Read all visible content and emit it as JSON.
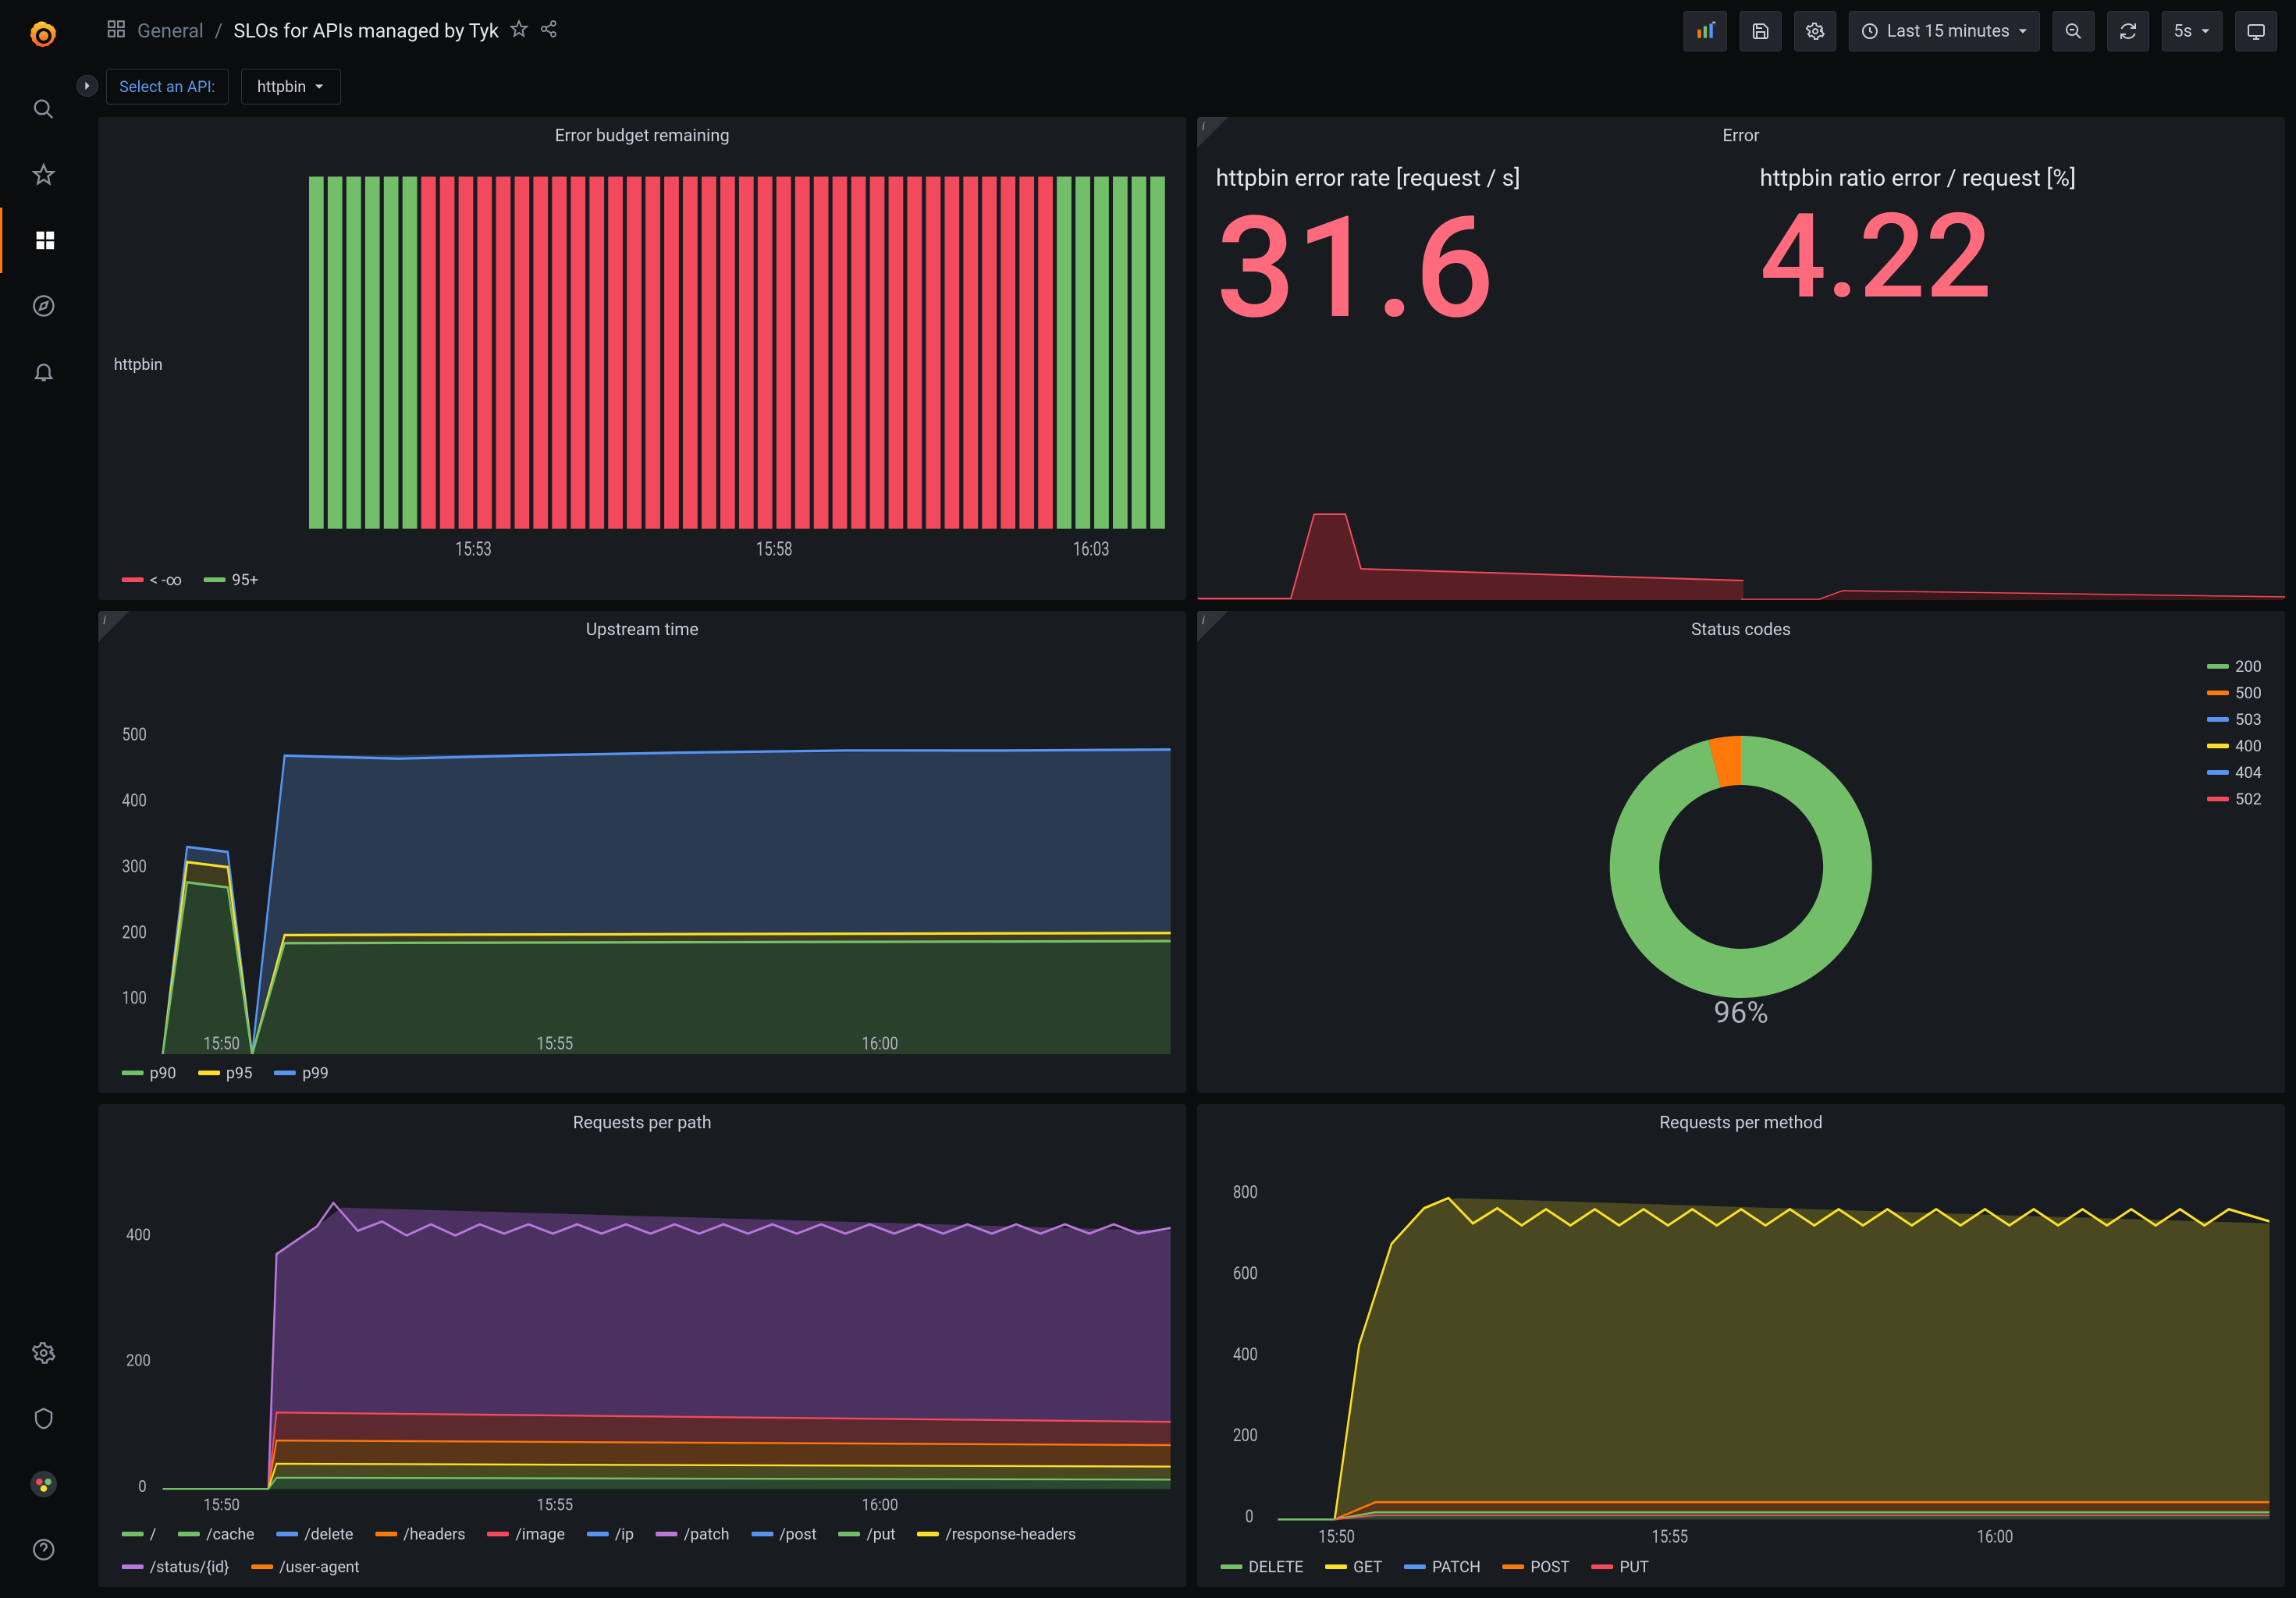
{
  "breadcrumb": {
    "folder": "General",
    "title": "SLOs for APIs managed by Tyk"
  },
  "topbar": {
    "time_range": "Last 15 minutes",
    "refresh_interval": "5s"
  },
  "variable": {
    "label": "Select an API:",
    "value": "httpbin"
  },
  "panels": {
    "error_budget": {
      "title": "Error budget remaining",
      "label": "httpbin",
      "legend": [
        "< -∞",
        "95+"
      ],
      "xticks": [
        "15:53",
        "15:58",
        "16:03"
      ]
    },
    "error": {
      "title": "Error",
      "rate_title": "httpbin error rate [request / s]",
      "rate_value": "31.6",
      "ratio_title": "httpbin ratio error / request [%]",
      "ratio_value": "4.22"
    },
    "upstream": {
      "title": "Upstream time",
      "legend": [
        "p90",
        "p95",
        "p99"
      ],
      "yticks": [
        "100",
        "200",
        "300",
        "400",
        "500"
      ],
      "xticks": [
        "15:50",
        "15:55",
        "16:00"
      ]
    },
    "status_codes": {
      "title": "Status codes",
      "center_label": "96%",
      "legend": [
        "200",
        "500",
        "503",
        "400",
        "404",
        "502"
      ]
    },
    "requests_path": {
      "title": "Requests per path",
      "yticks": [
        "0",
        "200",
        "400"
      ],
      "xticks": [
        "15:50",
        "15:55",
        "16:00"
      ],
      "legend": [
        "/",
        "/cache",
        "/delete",
        "/headers",
        "/image",
        "/ip",
        "/patch",
        "/post",
        "/put",
        "/response-headers",
        "/status/{id}",
        "/user-agent"
      ]
    },
    "requests_method": {
      "title": "Requests per method",
      "yticks": [
        "0",
        "200",
        "400",
        "600",
        "800"
      ],
      "xticks": [
        "15:50",
        "15:55",
        "16:00"
      ],
      "legend": [
        "DELETE",
        "GET",
        "PATCH",
        "POST",
        "PUT"
      ]
    }
  },
  "colors": {
    "green": "#73bf69",
    "yellow": "#fade2a",
    "blue": "#5794f2",
    "orange": "#ff780a",
    "red": "#f2495c",
    "purple": "#b877d9",
    "darkorange": "#e06910",
    "pink": "#e64a7a",
    "teal": "#5ec4b8"
  },
  "chart_data": [
    {
      "panel": "error_budget",
      "type": "bar",
      "categories_time": "15:49-16:03 (per-minute bars)",
      "series": [
        {
          "name": "httpbin",
          "bars_count": 46,
          "green_ranges": [
            [
              0,
              5
            ],
            [
              40,
              46
            ]
          ],
          "red_range": [
            5,
            40
          ]
        }
      ],
      "thresholds": {
        "red": "< -∞",
        "green": "95+"
      },
      "xticks": [
        "15:53",
        "15:58",
        "16:03"
      ]
    },
    {
      "panel": "error",
      "type": "stat",
      "metrics": [
        {
          "name": "httpbin error rate [request / s]",
          "value": 31.6
        },
        {
          "name": "httpbin ratio error / request [%]",
          "value": 4.22
        }
      ],
      "sparkline_rate": {
        "x": [
          "15:49",
          "15:50",
          "15:51",
          "15:52",
          "15:53",
          "16:03"
        ],
        "y": [
          0,
          0,
          190,
          60,
          30,
          30
        ]
      },
      "sparkline_ratio": {
        "x": [
          "15:49",
          "16:03"
        ],
        "y": [
          0,
          4
        ]
      }
    },
    {
      "panel": "upstream_time",
      "type": "line",
      "xlabel": "",
      "ylabel": "",
      "ylim": [
        0,
        550
      ],
      "x": [
        "15:49",
        "15:50",
        "15:51",
        "15:52",
        "15:53",
        "15:54",
        "15:55",
        "15:56",
        "15:57",
        "15:58",
        "15:59",
        "16:00",
        "16:01",
        "16:02",
        "16:03"
      ],
      "series": [
        {
          "name": "p90",
          "color": "#73bf69",
          "values": [
            0,
            250,
            0,
            180,
            185,
            190,
            190,
            190,
            190,
            190,
            190,
            190,
            190,
            190,
            190
          ]
        },
        {
          "name": "p95",
          "color": "#fade2a",
          "values": [
            0,
            280,
            0,
            195,
            200,
            200,
            200,
            200,
            200,
            200,
            200,
            200,
            200,
            200,
            200
          ]
        },
        {
          "name": "p99",
          "color": "#5794f2",
          "values": [
            0,
            300,
            0,
            445,
            450,
            448,
            452,
            455,
            458,
            455,
            458,
            460,
            458,
            460,
            460
          ]
        }
      ],
      "xticks": [
        "15:50",
        "15:55",
        "16:00"
      ]
    },
    {
      "panel": "status_codes",
      "type": "pie",
      "slices": [
        {
          "label": "200",
          "value": 96,
          "color": "#73bf69"
        },
        {
          "label": "500",
          "value": 3,
          "color": "#ff780a"
        },
        {
          "label": "503",
          "value": 0.3,
          "color": "#5794f2"
        },
        {
          "label": "400",
          "value": 0.3,
          "color": "#fade2a"
        },
        {
          "label": "404",
          "value": 0.2,
          "color": "#5794f2"
        },
        {
          "label": "502",
          "value": 0.2,
          "color": "#f2495c"
        }
      ],
      "center": "96%"
    },
    {
      "panel": "requests_per_path",
      "type": "area",
      "stacked": true,
      "xlabel": "",
      "ylabel": "",
      "ylim": [
        0,
        500
      ],
      "x": [
        "15:49",
        "15:50",
        "15:51",
        "15:52",
        "15:53",
        "15:54",
        "15:55",
        "15:56",
        "15:57",
        "15:58",
        "15:59",
        "16:00",
        "16:01",
        "16:02",
        "16:03"
      ],
      "series": [
        {
          "name": "/",
          "color": "#73bf69",
          "values": [
            0,
            0,
            25,
            25,
            25,
            25,
            25,
            25,
            25,
            25,
            25,
            25,
            25,
            25,
            25
          ]
        },
        {
          "name": "/cache",
          "color": "#73bf69",
          "values": [
            0,
            0,
            20,
            20,
            20,
            20,
            20,
            20,
            20,
            20,
            20,
            20,
            20,
            20,
            20
          ]
        },
        {
          "name": "/delete",
          "color": "#5794f2",
          "values": [
            0,
            0,
            15,
            15,
            15,
            15,
            15,
            15,
            15,
            15,
            15,
            15,
            15,
            15,
            15
          ]
        },
        {
          "name": "/headers",
          "color": "#ff780a",
          "values": [
            0,
            0,
            15,
            15,
            15,
            15,
            15,
            15,
            15,
            15,
            15,
            15,
            15,
            15,
            15
          ]
        },
        {
          "name": "/image",
          "color": "#f2495c",
          "values": [
            0,
            0,
            70,
            70,
            70,
            70,
            70,
            70,
            70,
            70,
            70,
            70,
            70,
            70,
            70
          ]
        },
        {
          "name": "/ip",
          "color": "#5794f2",
          "values": [
            0,
            0,
            15,
            15,
            15,
            15,
            15,
            15,
            15,
            15,
            15,
            15,
            15,
            15,
            15
          ]
        },
        {
          "name": "/patch",
          "color": "#b877d9",
          "values": [
            0,
            0,
            15,
            15,
            15,
            15,
            15,
            15,
            15,
            15,
            15,
            15,
            15,
            15,
            15
          ]
        },
        {
          "name": "/post",
          "color": "#5794f2",
          "values": [
            0,
            0,
            15,
            15,
            15,
            15,
            15,
            15,
            15,
            15,
            15,
            15,
            15,
            15,
            15
          ]
        },
        {
          "name": "/put",
          "color": "#73bf69",
          "values": [
            0,
            0,
            15,
            15,
            15,
            15,
            15,
            15,
            15,
            15,
            15,
            15,
            15,
            15,
            15
          ]
        },
        {
          "name": "/response-headers",
          "color": "#fade2a",
          "values": [
            0,
            0,
            15,
            15,
            15,
            15,
            15,
            15,
            15,
            15,
            15,
            15,
            15,
            15,
            15
          ]
        },
        {
          "name": "/status/{id}",
          "color": "#b877d9",
          "values": [
            0,
            180,
            200,
            220,
            210,
            205,
            210,
            205,
            208,
            210,
            205,
            208,
            205,
            208,
            205
          ]
        },
        {
          "name": "/user-agent",
          "color": "#ff780a",
          "values": [
            0,
            0,
            15,
            15,
            15,
            15,
            15,
            15,
            15,
            15,
            15,
            15,
            15,
            15,
            15
          ]
        }
      ],
      "xticks": [
        "15:50",
        "15:55",
        "16:00"
      ]
    },
    {
      "panel": "requests_per_method",
      "type": "area",
      "stacked": true,
      "xlabel": "",
      "ylabel": "",
      "ylim": [
        0,
        850
      ],
      "x": [
        "15:49",
        "15:50",
        "15:51",
        "15:52",
        "15:53",
        "15:54",
        "15:55",
        "15:56",
        "15:57",
        "15:58",
        "15:59",
        "16:00",
        "16:01",
        "16:02",
        "16:03"
      ],
      "series": [
        {
          "name": "DELETE",
          "color": "#73bf69",
          "values": [
            0,
            0,
            20,
            20,
            20,
            20,
            20,
            20,
            20,
            20,
            20,
            20,
            20,
            20,
            20
          ]
        },
        {
          "name": "GET",
          "color": "#fade2a",
          "values": [
            0,
            350,
            600,
            700,
            720,
            700,
            680,
            700,
            680,
            700,
            680,
            690,
            680,
            690,
            680
          ]
        },
        {
          "name": "PATCH",
          "color": "#5794f2",
          "values": [
            0,
            0,
            10,
            10,
            10,
            10,
            10,
            10,
            10,
            10,
            10,
            10,
            10,
            10,
            10
          ]
        },
        {
          "name": "POST",
          "color": "#ff780a",
          "values": [
            0,
            0,
            20,
            20,
            20,
            20,
            20,
            20,
            20,
            20,
            20,
            20,
            20,
            20,
            20
          ]
        },
        {
          "name": "PUT",
          "color": "#f2495c",
          "values": [
            0,
            0,
            10,
            10,
            10,
            10,
            10,
            10,
            10,
            10,
            10,
            10,
            10,
            10,
            10
          ]
        }
      ],
      "xticks": [
        "15:50",
        "15:55",
        "16:00"
      ]
    }
  ]
}
